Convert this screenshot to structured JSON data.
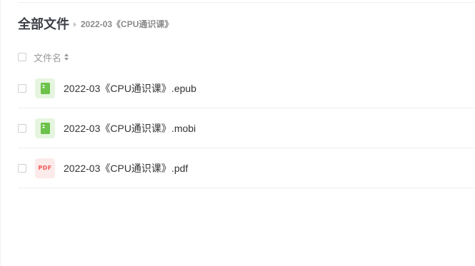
{
  "breadcrumb": {
    "root": "全部文件",
    "separator_icon": "chevron-right-icon",
    "current": "2022-03《CPU通识课》"
  },
  "list_header": {
    "name_label": "文件名",
    "sort_icon": "sort-icon"
  },
  "files": [
    {
      "name": "2022-03《CPU通识课》.epub",
      "icon": "book-icon"
    },
    {
      "name": "2022-03《CPU通识课》.mobi",
      "icon": "book-icon"
    },
    {
      "name": "2022-03《CPU通识课》.pdf",
      "icon": "pdf-icon",
      "icon_label": "PDF"
    }
  ],
  "colors": {
    "book_icon": "#6cc24a",
    "pdf_icon": "#f15a5a",
    "text_primary": "#333333",
    "text_secondary": "#999999"
  }
}
